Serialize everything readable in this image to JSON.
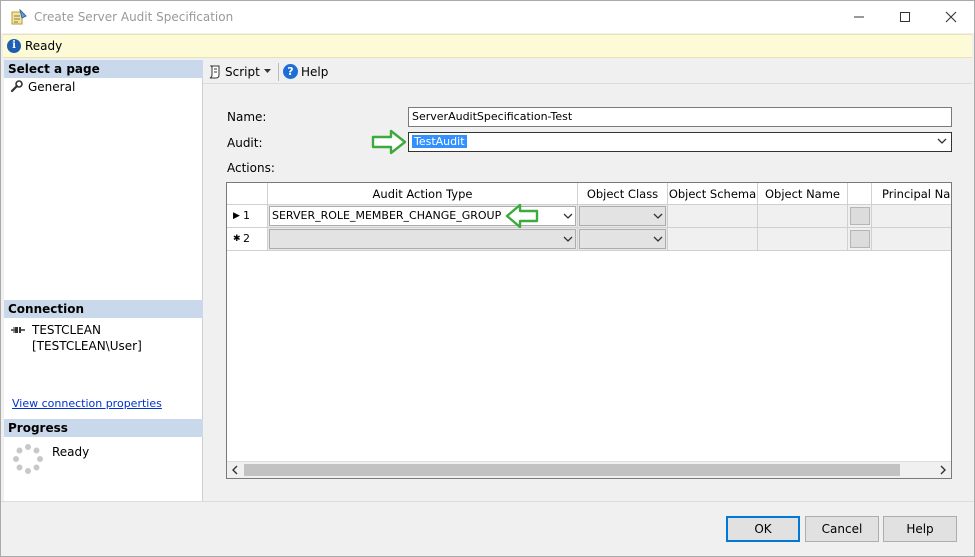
{
  "window": {
    "title": "Create Server Audit Specification"
  },
  "status": {
    "text": "Ready"
  },
  "left": {
    "select_page_header": "Select a page",
    "pages": [
      {
        "label": "General",
        "icon": "wrench-icon"
      }
    ],
    "connection_header": "Connection",
    "connection_value": "TESTCLEAN [TESTCLEAN\\User]",
    "view_connection_link": "View connection properties",
    "progress_header": "Progress",
    "progress_text": "Ready"
  },
  "toolbar": {
    "script_label": "Script",
    "help_label": "Help"
  },
  "form": {
    "name_label": "Name:",
    "name_value": "ServerAuditSpecification-Test",
    "audit_label": "Audit:",
    "audit_value": "TestAudit",
    "actions_label": "Actions:"
  },
  "grid": {
    "columns": [
      "",
      "Audit Action Type",
      "Object Class",
      "Object Schema",
      "Object Name",
      "",
      "Principal Name"
    ],
    "rows": [
      {
        "marker": "▶",
        "num": "1",
        "action_type": "SERVER_ROLE_MEMBER_CHANGE_GROUP"
      },
      {
        "marker": "✱",
        "num": "2",
        "action_type": ""
      }
    ]
  },
  "buttons": {
    "ok": "OK",
    "cancel": "Cancel",
    "help": "Help"
  },
  "colors": {
    "header_band": "#c9d8ea",
    "status_bg": "#fdfad8",
    "selection": "#3390ff",
    "annotation_arrow": "#3caa3c",
    "link": "#0033cc"
  }
}
